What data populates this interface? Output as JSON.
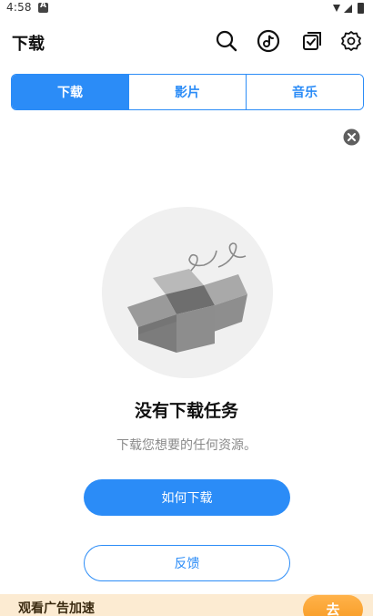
{
  "status_bar": {
    "time": "4:58"
  },
  "header": {
    "title": "下载",
    "icons": [
      "search-icon",
      "tiktok-music-icon",
      "checklist-icon",
      "settings-icon"
    ]
  },
  "tabs": [
    {
      "label": "下载",
      "active": true
    },
    {
      "label": "影片",
      "active": false
    },
    {
      "label": "音乐",
      "active": false
    }
  ],
  "empty_state": {
    "title": "没有下载任务",
    "subtitle": "下载您想要的任何资源。"
  },
  "buttons": {
    "how_to_download": "如何下载",
    "feedback": "反馈"
  },
  "ad_banner": {
    "text": "观看广告加速",
    "go_label": "去"
  },
  "colors": {
    "accent": "#2b8cf7",
    "ad_background": "#fcebd2",
    "ad_button": "#f79a22"
  }
}
